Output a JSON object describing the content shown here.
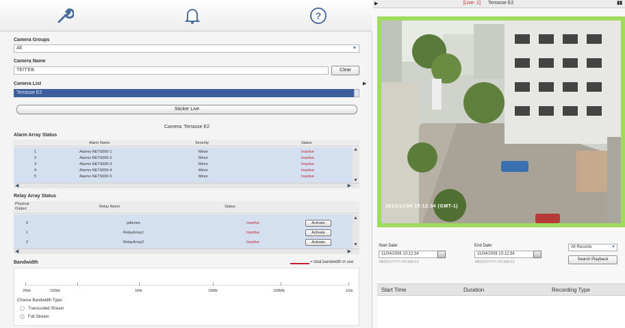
{
  "toolbar": {
    "icons": [
      "wrench-icon",
      "bell-icon",
      "help-icon"
    ]
  },
  "camera_groups": {
    "label": "Camera Groups",
    "value": "All"
  },
  "camera_name": {
    "label": "Camera Name",
    "value": "ТЕГГЕВ",
    "clear_label": "Clear"
  },
  "camera_list": {
    "label": "Camera List",
    "selected": "Terrasse E2"
  },
  "sticker_button": "Sticker Live",
  "camera_caption": "Camera: Terrasse E2",
  "alarm": {
    "title": "Alarm Array Status",
    "headers": [
      "",
      "Alarm Name",
      "Severity",
      "Status"
    ],
    "rows": [
      {
        "id": "1",
        "name": "Alarms NETS000-1",
        "severity": "Minor",
        "status": "Inactive"
      },
      {
        "id": "2",
        "name": "Alarms NETS000-2",
        "severity": "Minor",
        "status": "Inactive"
      },
      {
        "id": "3",
        "name": "Alarms NETS000-3",
        "severity": "Minor",
        "status": "Inactive"
      },
      {
        "id": "4",
        "name": "Alarms NETS000-4",
        "severity": "Minor",
        "status": "Inactive"
      },
      {
        "id": "5",
        "name": "Alarms NETS000-5",
        "severity": "Minor",
        "status": "Inactive"
      }
    ]
  },
  "relay": {
    "title": "Relay Array Status",
    "headers": [
      "Physical Output",
      "Relay Name",
      "Status"
    ],
    "rows": [
      {
        "id": "0",
        "name": "pdtenes",
        "status": "Inactive",
        "button": "Activate"
      },
      {
        "id": "1",
        "name": "RelayArray1",
        "status": "Inactive",
        "button": "Activate"
      },
      {
        "id": "2",
        "name": "RelayArray2",
        "status": "Inactive",
        "button": "Activate"
      }
    ]
  },
  "bandwidth": {
    "title": "Bandwidth",
    "legend": "= total bandwidth in use",
    "scale": [
      "20kb",
      "100kb",
      "1Mb",
      "10Mb",
      "100Mb",
      "1Gb"
    ],
    "choose_label": "Choose Bandwidth Type:",
    "options": [
      "Transcoded Stream",
      "Full Stream"
    ]
  },
  "video": {
    "live_tag": "[Live- 1]",
    "camera_title": "Terrasse E2",
    "timestamp": "2013/11/04 10:12:34 (GMT-1)"
  },
  "playback": {
    "start_label": "Start Date:",
    "start_value": "11/04/2008 10:12:34",
    "end_label": "End Date:",
    "end_value": "11/04/2008 10:12:34",
    "hint": "MM/DD/YYYY HH:MM:SS",
    "records_select": "All Records",
    "search_button": "Search Playback"
  },
  "recordings": {
    "headers": [
      "Start Time",
      "Duration",
      "Recording Type"
    ]
  },
  "colors": {
    "video_border": "#9fdc5e",
    "selection": "#3d5f9e",
    "inactive": "#c0202a",
    "table_bg": "#d4dff0"
  }
}
